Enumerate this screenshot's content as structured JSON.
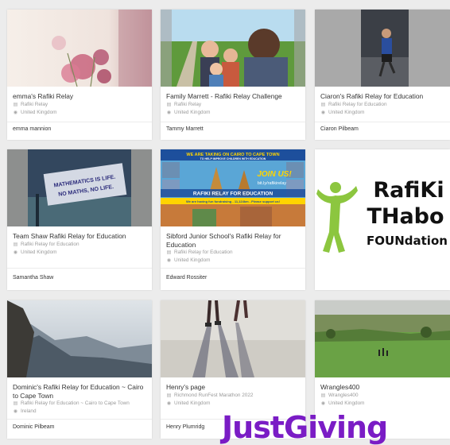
{
  "brand": {
    "name": "JustGiving"
  },
  "cards": [
    {
      "title": "emma's Rafiki Relay",
      "team": "Rafiki Relay",
      "location": "United Kingdom",
      "owner": "emma mannion",
      "image": "pink-flowers"
    },
    {
      "title": "Family Marrett - Rafiki Relay Challenge",
      "team": "Rafiki Relay",
      "location": "United Kingdom",
      "owner": "Tammy Marrett",
      "image": "family-selfie"
    },
    {
      "title": "Ciaron's Rafiki Relay for Education",
      "team": "Rafiki Relay for Education",
      "location": "United Kingdom",
      "owner": "Ciaron Pilbeam",
      "image": "runner-night"
    },
    {
      "title": "Team Shaw Rafiki Relay for Education",
      "team": "Rafiki Relay for Education",
      "location": "United Kingdom",
      "owner": "Samantha Shaw",
      "image": "maths-sign"
    },
    {
      "title": "Sibford Junior School's Rafiki Relay for Education",
      "team": "Rafiki Relay for Education",
      "location": "United Kingdom",
      "owner": "Edward Rossiter",
      "image": "relay-poster"
    },
    {
      "title": "",
      "team": "",
      "location": "",
      "owner": "",
      "image": "rafiki-logo"
    },
    {
      "title": "Dominic's Rafiki Relay for Education ~ Cairo to Cape Town",
      "team": "Rafiki Relay for Education ~ Cairo to Cape Town",
      "location": "Ireland",
      "owner": "Dominic Pilbeam",
      "image": "mountains"
    },
    {
      "title": "Henry's page",
      "team": "Richmond RunFest Marathon 2022",
      "location": "United Kingdom",
      "owner": "Henry Plumridg",
      "image": "runners-legs"
    },
    {
      "title": "Wrangles400",
      "team": "Wrangles400",
      "location": "United Kingdom",
      "owner": "",
      "image": "countryside"
    }
  ],
  "poster": {
    "headline": "WE ARE TAKING ON CAIRO TO CAPE TOWN",
    "subline": "TO HELP IMPROVE CHILDREN WITH EDUCATION",
    "join": "JOIN US!",
    "link": "bit.ly/rafikirelay",
    "banner": "RAFIKI RELAY FOR EDUCATION",
    "footer": "We are having fun fundraising - 11,124km - Please support us!"
  },
  "maths_sign": "MATHEMATICS IS LIFE. NO MATHS, NO LIFE.",
  "logo": {
    "line1": "RafiKi",
    "line2": "THabo",
    "line3": "FOUNdation"
  },
  "colors": {
    "brand_purple": "#7a1cc5",
    "logo_green": "#8cc63f"
  }
}
